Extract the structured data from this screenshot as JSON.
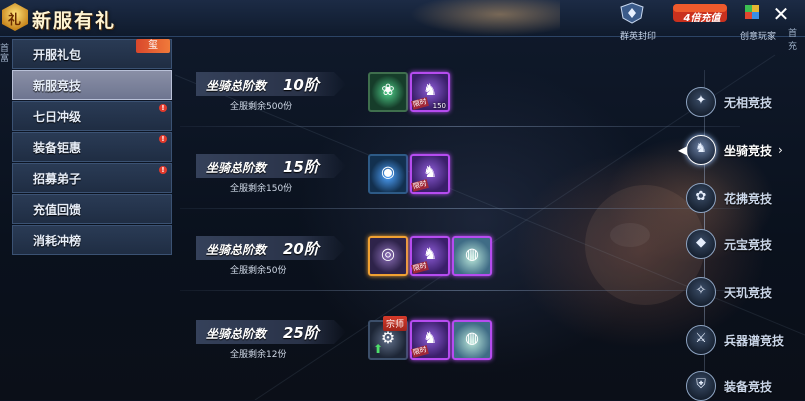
{
  "header": {
    "emblem_char": "礼",
    "title": "新服有礼",
    "icons": [
      {
        "name": "shield-icon",
        "label": "群英封印"
      },
      {
        "name": "recharge-icon",
        "label": "4倍充值"
      },
      {
        "name": "cube-icon",
        "label": "创意玩家"
      }
    ],
    "close_label": "✕",
    "edge_tag": "首充",
    "left_tag": "首富"
  },
  "menu": {
    "badge": "玺",
    "items": [
      {
        "label": "开服礼包",
        "active": false,
        "dot": false
      },
      {
        "label": "新服竞技",
        "active": true,
        "dot": false
      },
      {
        "label": "七日冲级",
        "active": false,
        "dot": true
      },
      {
        "label": "装备钜惠",
        "active": false,
        "dot": true
      },
      {
        "label": "招募弟子",
        "active": false,
        "dot": true
      },
      {
        "label": "充值回馈",
        "active": false,
        "dot": false
      },
      {
        "label": "消耗冲榜",
        "active": false,
        "dot": false
      }
    ]
  },
  "rows": [
    {
      "title": "坐骑总阶数",
      "level": "10阶",
      "remain": "全服剩余500份",
      "items": [
        {
          "kind": "green",
          "glyph": "❀",
          "icon": "green-orb-icon"
        },
        {
          "kind": "purple",
          "glyph": "♞",
          "icon": "mount-icon",
          "tag": "限时",
          "count": "150"
        }
      ]
    },
    {
      "title": "坐骑总阶数",
      "level": "15阶",
      "remain": "全服剩余150份",
      "items": [
        {
          "kind": "blue",
          "glyph": "◉",
          "icon": "blue-orb-icon"
        },
        {
          "kind": "purple",
          "glyph": "♞",
          "icon": "mount-icon",
          "tag": "限时"
        }
      ]
    },
    {
      "title": "坐骑总阶数",
      "level": "20阶",
      "remain": "全服剩余50份",
      "items": [
        {
          "kind": "orange",
          "glyph": "◎",
          "icon": "vortex-icon"
        },
        {
          "kind": "purple",
          "glyph": "♞",
          "icon": "mount-icon",
          "tag": "限时"
        },
        {
          "kind": "peach",
          "glyph": "◍",
          "icon": "peach-icon"
        }
      ]
    },
    {
      "title": "坐骑总阶数",
      "level": "25阶",
      "remain": "全服剩余12份",
      "badge": "宗师",
      "items": [
        {
          "kind": "gear",
          "glyph": "⚙",
          "icon": "upgrade-stone-icon",
          "arrow": "⬆"
        },
        {
          "kind": "purple",
          "glyph": "♞",
          "icon": "mount-icon",
          "tag": "限时"
        },
        {
          "kind": "peach",
          "glyph": "◍",
          "icon": "peach-icon"
        }
      ]
    }
  ],
  "categories": [
    {
      "label": "无相竞技",
      "glyph": "✦",
      "active": false
    },
    {
      "label": "坐骑竞技",
      "glyph": "♞",
      "active": true
    },
    {
      "label": "花拂竞技",
      "glyph": "✿",
      "active": false
    },
    {
      "label": "元宝竞技",
      "glyph": "◆",
      "active": false
    },
    {
      "label": "天玑竞技",
      "glyph": "✧",
      "active": false
    },
    {
      "label": "兵器谱竞技",
      "glyph": "⚔",
      "active": false
    },
    {
      "label": "装备竞技",
      "glyph": "⛨",
      "active": false
    }
  ]
}
